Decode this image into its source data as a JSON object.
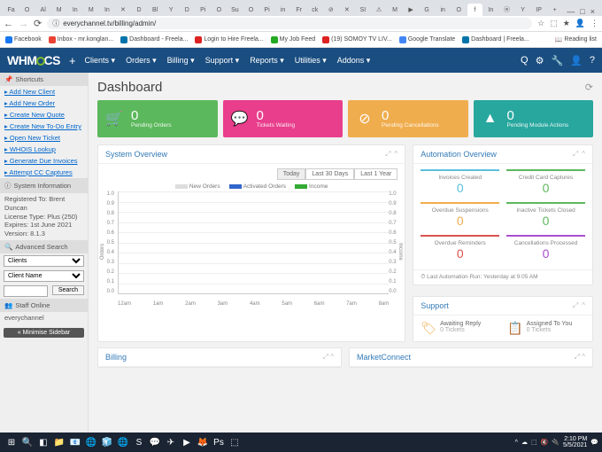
{
  "browser": {
    "tabs": [
      "Fa",
      "O",
      "Al",
      "M",
      "In",
      "M",
      "In",
      "✕",
      "D",
      "Bl",
      "Y",
      "D",
      "Pi",
      "O",
      "Su",
      "O",
      "Pi",
      "in",
      "Fr",
      "ck",
      "⊘",
      "✕",
      "SI",
      "⚠",
      "M",
      "▶",
      "G",
      "in",
      "O",
      "f",
      "In",
      "ⓦ",
      "Y",
      "IP",
      "+"
    ],
    "window_controls": [
      "—",
      "□",
      "×"
    ],
    "nav": {
      "back": "←",
      "fwd": "→",
      "reload": "⟳"
    },
    "url": "everychannel.tv/billing/admin/",
    "addr_icons": [
      "☆",
      "⬚",
      "★",
      "👤",
      "⋮"
    ],
    "bookmarks": [
      {
        "c": "#1877f2",
        "t": "Facebook"
      },
      {
        "c": "#ea4335",
        "t": "Inbox - mr.konglan..."
      },
      {
        "c": "#0073aa",
        "t": "Dashboard - Freela..."
      },
      {
        "c": "#d22",
        "t": "Login to Hire Freela..."
      },
      {
        "c": "#2a2",
        "t": "My Job Feed"
      },
      {
        "c": "#d22",
        "t": "(19) SOMOY TV LIV..."
      },
      {
        "c": "#4285f4",
        "t": "Google Translate"
      },
      {
        "c": "#0073aa",
        "t": "Dashboard | Freela..."
      }
    ],
    "reading_list": "Reading list"
  },
  "header": {
    "logo": "WHM",
    "logo2": "CS",
    "menu": [
      "Clients ▾",
      "Orders ▾",
      "Billing ▾",
      "Support ▾",
      "Reports ▾",
      "Utilities ▾",
      "Addons ▾"
    ],
    "icons": [
      "Q",
      "⚙",
      "🔧",
      "👤",
      "?"
    ]
  },
  "sidebar": {
    "sections": {
      "shortcuts": {
        "title": "Shortcuts",
        "items": [
          "Add New Client",
          "Add New Order",
          "Create New Quote",
          "Create New To-Do Entry",
          "Open New Ticket",
          "WHOIS Lookup",
          "Generate Due Invoices",
          "Attempt CC Captures"
        ]
      },
      "sysinfo": {
        "title": "System Information",
        "lines": [
          "Registered To: Brent Duncan",
          "License Type: Plus (250)",
          "Expires: 1st June 2021",
          "Version: 8.1.3"
        ]
      },
      "search": {
        "title": "Advanced Search",
        "sel1": "Clients",
        "sel2": "Client Name",
        "btn": "Search"
      },
      "staff": {
        "title": "Staff Online",
        "user": "everychannel"
      }
    },
    "minimise": "« Minimise Sidebar"
  },
  "dash": {
    "title": "Dashboard",
    "widgets": [
      {
        "cls": "green",
        "icon": "🛒",
        "n": "0",
        "l": "Pending Orders"
      },
      {
        "cls": "pink",
        "icon": "💬",
        "n": "0",
        "l": "Tickets Waiting"
      },
      {
        "cls": "orange",
        "icon": "⊘",
        "n": "0",
        "l": "Pending Cancellations"
      },
      {
        "cls": "teal",
        "icon": "▲",
        "n": "0",
        "l": "Pending Module Actions"
      }
    ],
    "sysov": {
      "title": "System Overview",
      "time_btns": [
        "Today",
        "Last 30 Days",
        "Last 1 Year"
      ],
      "legend": [
        {
          "c": "#ddd",
          "t": "New Orders"
        },
        {
          "c": "#36c",
          "t": "Activated Orders"
        },
        {
          "c": "#3a3",
          "t": "Income"
        }
      ],
      "ylabel": "Orders",
      "ylabel2": "Income"
    },
    "autoov": {
      "title": "Automation Overview",
      "items": [
        {
          "c": "#5bc0de",
          "l": "Invoices Created",
          "v": "0"
        },
        {
          "c": "#5cb85c",
          "l": "Credit Card Captures",
          "v": "0"
        },
        {
          "c": "#f0ad4e",
          "l": "Overdue Suspensions",
          "v": "0"
        },
        {
          "c": "#5cb85c",
          "l": "Inactive Tickets Closed",
          "v": "0"
        },
        {
          "c": "#d9534f",
          "l": "Overdue Reminders",
          "v": "0"
        },
        {
          "c": "#a94ecf",
          "l": "Cancellations Processed",
          "v": "0"
        }
      ],
      "foot": "⏱ Last Automation Run: Yesterday at 9:05 AM"
    },
    "support": {
      "title": "Support",
      "items": [
        {
          "ico": "🏷",
          "c": "#f0ad4e",
          "t": "Awaiting Reply",
          "s": "0 Tickets"
        },
        {
          "ico": "📋",
          "c": "#d9534f",
          "t": "Assigned To You",
          "s": "0 Tickets"
        }
      ]
    },
    "bottom": {
      "billing": "Billing",
      "market": "MarketConnect"
    }
  },
  "taskbar": {
    "items": [
      "⊞",
      "🔍",
      "◧",
      "📁",
      "📧",
      "🌐",
      "🧊",
      "🌐",
      "S",
      "💬",
      "✈",
      "▶",
      "🦊",
      "Ps",
      "⬚"
    ],
    "tray": [
      "^",
      "☁",
      "⬚",
      "🔇",
      "🔌"
    ],
    "time": "2:10 PM",
    "date": "5/5/2021"
  },
  "chart_data": {
    "type": "line",
    "series": [
      {
        "name": "New Orders",
        "values": [
          0,
          0,
          0,
          0,
          0,
          0,
          0,
          0,
          0
        ]
      },
      {
        "name": "Activated Orders",
        "values": [
          0,
          0,
          0,
          0,
          0,
          0,
          0,
          0,
          0
        ]
      },
      {
        "name": "Income",
        "values": [
          0,
          0,
          0,
          0,
          0,
          0,
          0,
          0,
          0
        ]
      }
    ],
    "x": [
      "12am",
      "1am",
      "2am",
      "3am",
      "4am",
      "5am",
      "6am",
      "7am",
      "8am"
    ],
    "ylim": [
      0,
      1.0
    ],
    "yticks": [
      "1.0",
      "0.9",
      "0.8",
      "0.7",
      "0.6",
      "0.5",
      "0.4",
      "0.3",
      "0.2",
      "0.1",
      "0.0"
    ],
    "ylabel": "Orders",
    "ylabel2": "Income"
  }
}
